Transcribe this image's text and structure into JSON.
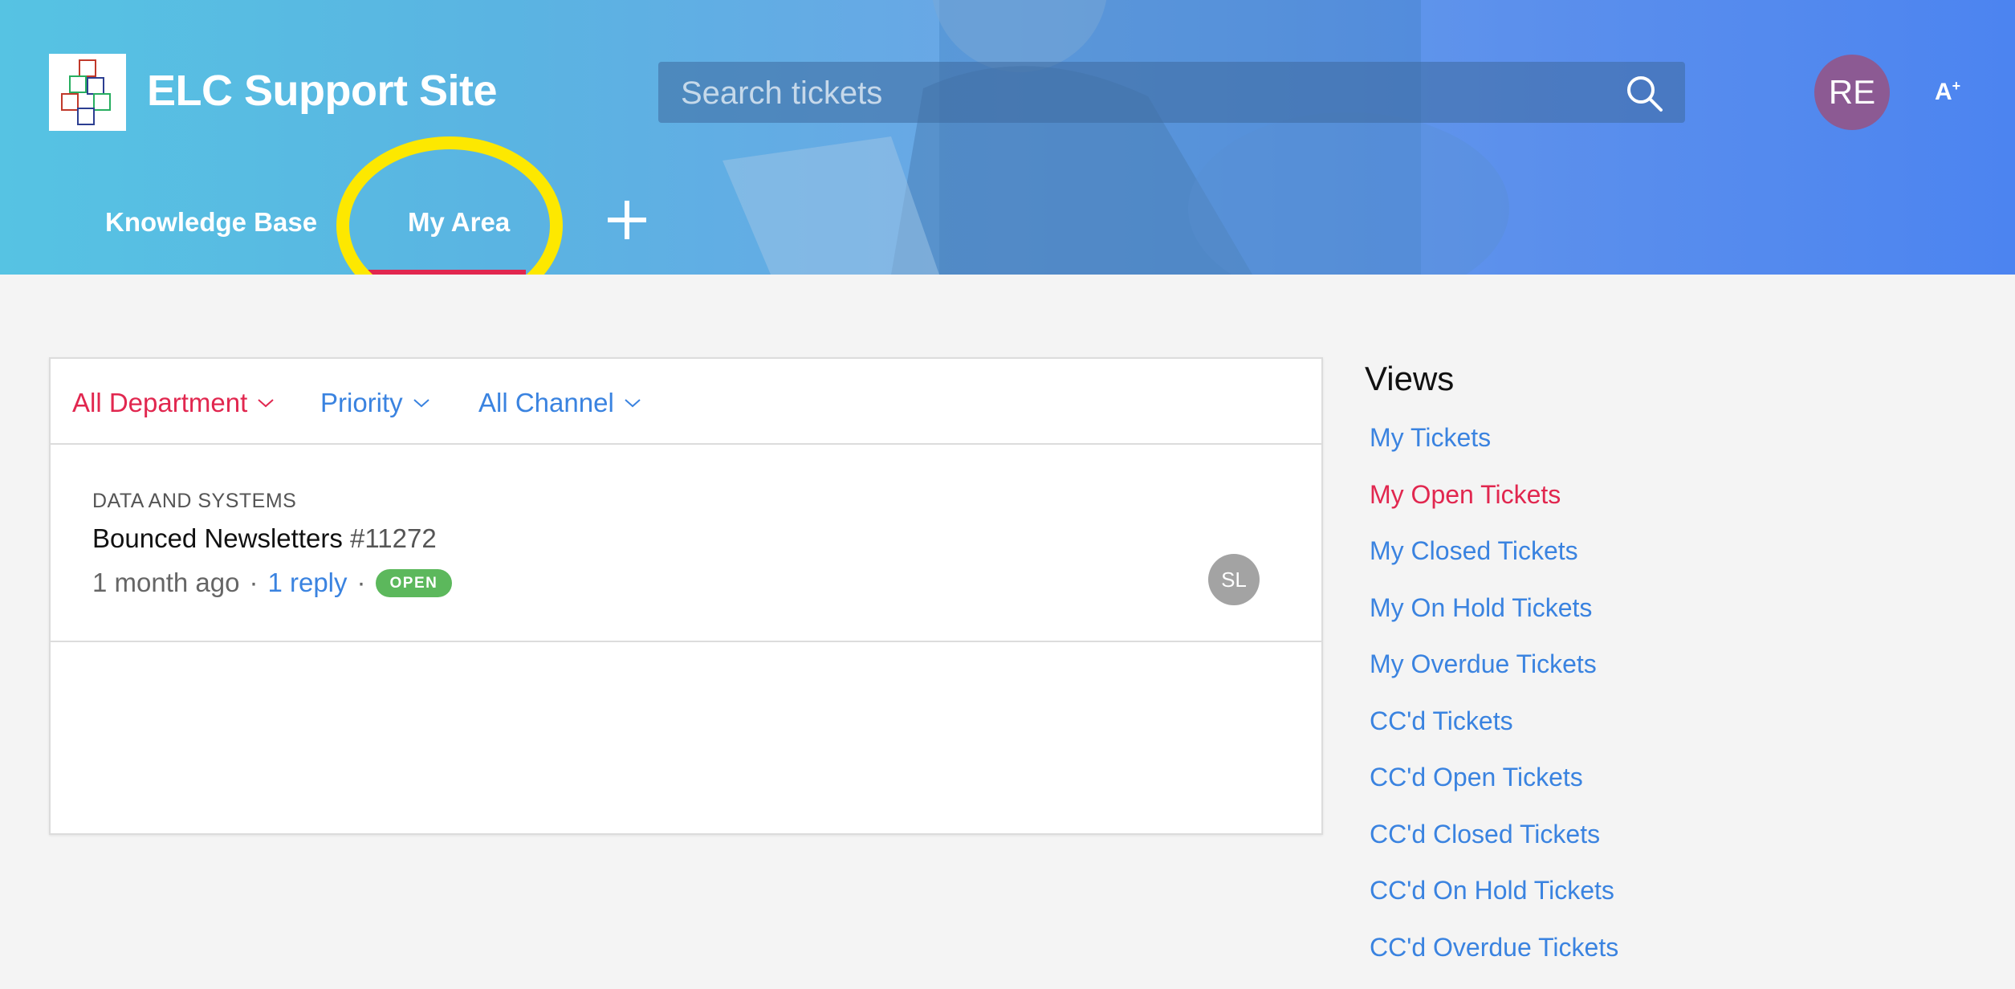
{
  "header": {
    "site_title": "ELC Support Site",
    "logo_alt": "ELC blocks logo",
    "search_placeholder": "Search tickets",
    "user_initials": "RE",
    "accessibility_label": "A",
    "nav": [
      {
        "label": "Knowledge Base",
        "active": false
      },
      {
        "label": "My Area",
        "active": true
      }
    ],
    "add_icon": "plus-icon"
  },
  "filters": [
    {
      "label": "All Department",
      "active": true
    },
    {
      "label": "Priority",
      "active": false
    },
    {
      "label": "All Channel",
      "active": false
    }
  ],
  "tickets": [
    {
      "department": "DATA AND SYSTEMS",
      "subject": "Bounced Newsletters",
      "number": "#11272",
      "age": "1 month ago",
      "replies": "1 reply",
      "status": "OPEN",
      "assignee_initials": "SL"
    }
  ],
  "views": {
    "title": "Views",
    "items": [
      {
        "label": "My Tickets",
        "active": false
      },
      {
        "label": "My Open Tickets",
        "active": true
      },
      {
        "label": "My Closed Tickets",
        "active": false
      },
      {
        "label": "My On Hold Tickets",
        "active": false
      },
      {
        "label": "My Overdue Tickets",
        "active": false
      },
      {
        "label": "CC'd Tickets",
        "active": false
      },
      {
        "label": "CC'd Open Tickets",
        "active": false
      },
      {
        "label": "CC'd Closed Tickets",
        "active": false
      },
      {
        "label": "CC'd On Hold Tickets",
        "active": false
      },
      {
        "label": "CC'd Overdue Tickets",
        "active": false
      }
    ]
  },
  "colors": {
    "accent_red": "#e1274f",
    "link_blue": "#3a83e0",
    "status_open": "#5cb85c",
    "highlight_yellow": "#fde800",
    "avatar_purple": "#8c5a93"
  }
}
